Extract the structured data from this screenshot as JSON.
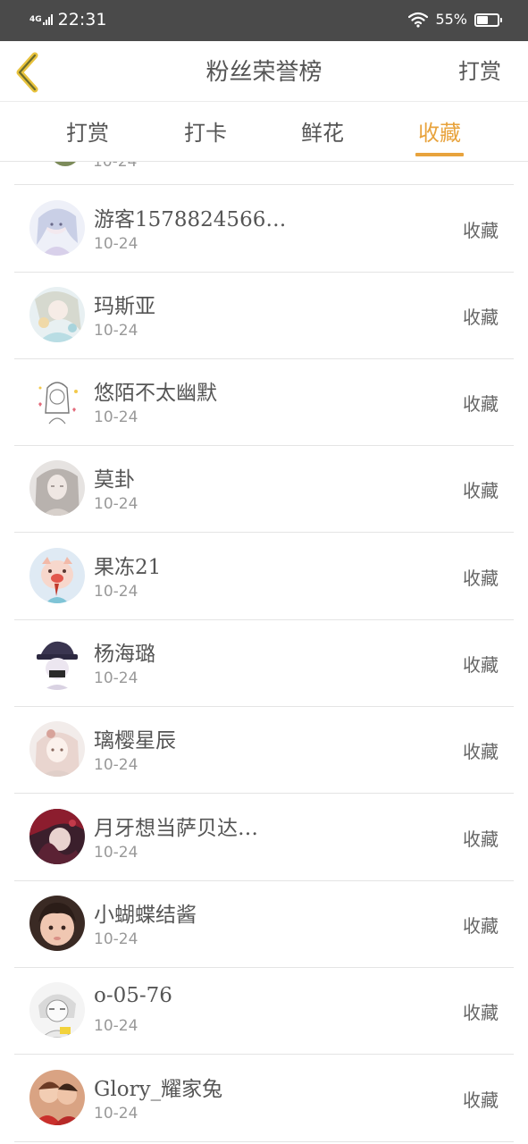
{
  "status_bar": {
    "network": "4G",
    "time": "22:31",
    "battery_percent": "55%",
    "battery_level": 0.55
  },
  "header": {
    "back_icon": "chevron-left-icon",
    "title": "粉丝荣誉榜",
    "action_label": "打赏"
  },
  "tabs": [
    {
      "label": "打赏",
      "active": false
    },
    {
      "label": "打卡",
      "active": false
    },
    {
      "label": "鲜花",
      "active": false
    },
    {
      "label": "收藏",
      "active": true
    }
  ],
  "colors": {
    "accent": "#e8a33d",
    "status_bar": "#4a4a4a",
    "text": "#555555",
    "secondary_text": "#999999"
  },
  "list": {
    "partial_top_date": "10-24",
    "items": [
      {
        "name": "游客1578824566…",
        "date": "10-24",
        "action": "收藏",
        "avatar": "anime-girl-avatar-1"
      },
      {
        "name": "玛斯亚",
        "date": "10-24",
        "action": "收藏",
        "avatar": "anime-girl-avatar-2"
      },
      {
        "name": "悠陌不太幽默",
        "date": "10-24",
        "action": "收藏",
        "avatar": "sketch-girl-avatar"
      },
      {
        "name": "莫卦",
        "date": "10-24",
        "action": "收藏",
        "avatar": "gray-girl-avatar"
      },
      {
        "name": "果冻21",
        "date": "10-24",
        "action": "收藏",
        "avatar": "pig-cartoon-avatar"
      },
      {
        "name": "杨海璐",
        "date": "10-24",
        "action": "收藏",
        "avatar": "hat-character-avatar"
      },
      {
        "name": "璃樱星辰",
        "date": "10-24",
        "action": "收藏",
        "avatar": "anime-girl-avatar-3"
      },
      {
        "name": "月牙想当萨贝达…",
        "date": "10-24",
        "action": "收藏",
        "avatar": "red-dark-avatar"
      },
      {
        "name": "小蝴蝶结酱",
        "date": "10-24",
        "action": "收藏",
        "avatar": "child-photo-avatar"
      },
      {
        "name": "o-05-76",
        "date": "10-24",
        "action": "收藏",
        "avatar": "sketch-boy-avatar"
      },
      {
        "name": "Glory_耀家兔",
        "date": "10-24",
        "action": "收藏",
        "avatar": "couple-photo-avatar"
      }
    ]
  }
}
